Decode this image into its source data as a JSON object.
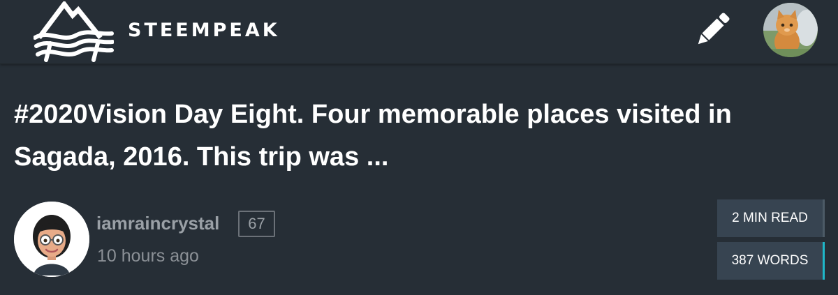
{
  "header": {
    "brand_name": "STEEMPEAK",
    "logo_icon": "mountain-wave-logo",
    "compose_icon": "pencil-icon",
    "user_avatar_icon": "kitten-avatar"
  },
  "post": {
    "title": "#2020Vision Day Eight. Four memorable places visited in Sagada, 2016. This trip was ...",
    "author": {
      "name": "iamraincrystal",
      "reputation": "67",
      "avatar_icon": "bitmoji-avatar"
    },
    "timestamp": "10 hours ago",
    "read_time": "2 MIN READ",
    "word_count": "387 WORDS"
  },
  "colors": {
    "background": "#262e36",
    "badge_background": "#374451",
    "accent": "#1fb7c9",
    "muted_text": "#9aa0a6"
  }
}
